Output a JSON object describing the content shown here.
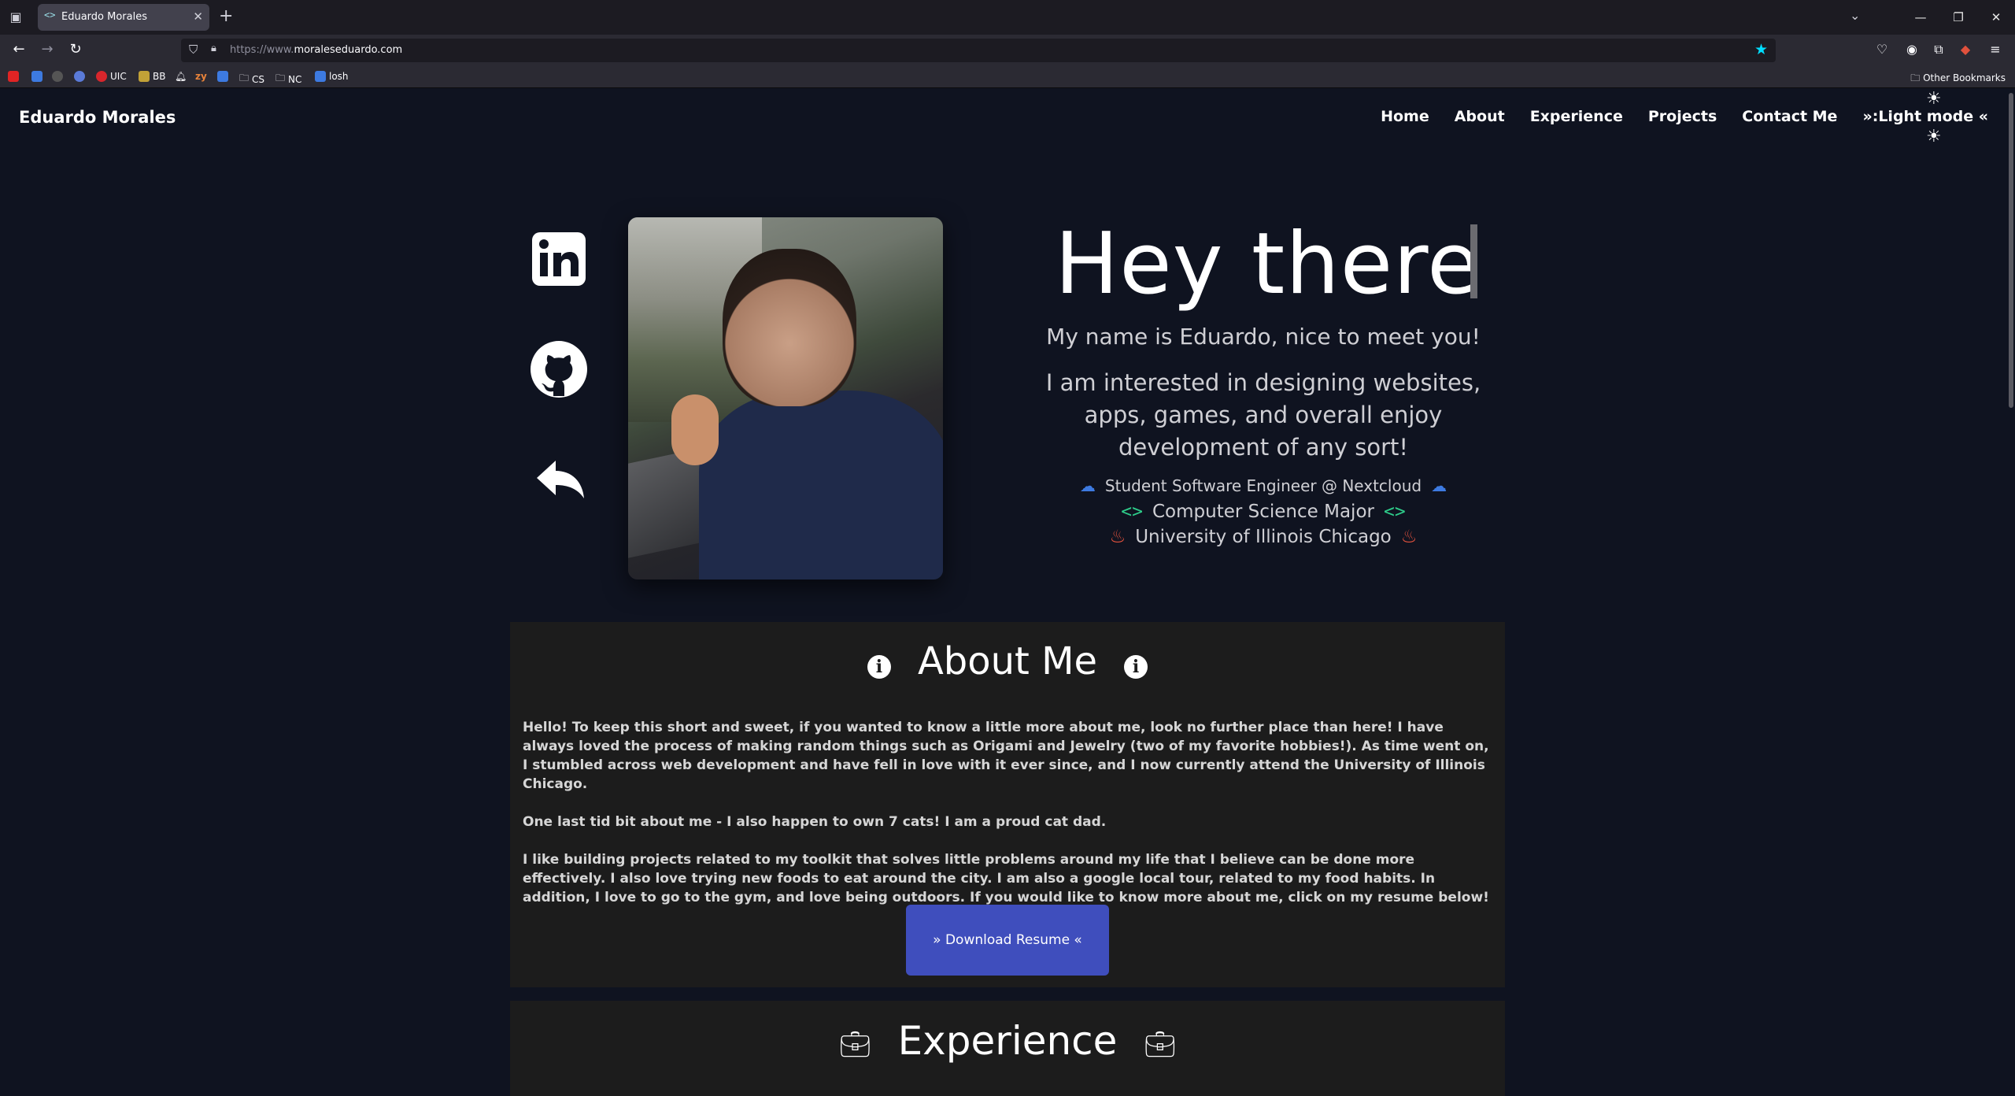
{
  "browser": {
    "tab_title": "Eduardo Morales",
    "tab_favicon": "<>",
    "url_prefix": "https://www.",
    "url_domain": "moraleseduardo.com",
    "bookmarks": [
      "UIC",
      "BB",
      "zy",
      "CS",
      "NC",
      "losh"
    ],
    "other_bookmarks": "Other Bookmarks"
  },
  "site": {
    "brand": "Eduardo Morales",
    "nav": [
      "Home",
      "About",
      "Experience",
      "Projects",
      "Contact Me",
      "»:Light mode «"
    ],
    "hero": {
      "title": "Hey there",
      "intro": "My name is Eduardo, nice to meet you!",
      "interest": "I am interested in designing websites, apps, games, and overall enjoy development of any sort!",
      "role": "Student Software Engineer @ Nextcloud",
      "major": "Computer Science Major",
      "school": "University of Illinois Chicago"
    },
    "about": {
      "title": "About Me",
      "p1": "Hello! To keep this short and sweet, if you wanted to know a little more about me, look no further place than here! I have always loved the process of making random things such as Origami and Jewelry (two of my favorite hobbies!). As time went on, I stumbled across web development and have fell in love with it ever since, and I now currently attend the University of Illinois Chicago.",
      "p2": "One last tid bit about me - I also happen to own 7 cats! I am a proud cat dad.",
      "p3": "I like building projects related to my toolkit that solves little problems around my life that I believe can be done more effectively. I also love trying new foods to eat around the city. I am also a google local tour, related to my food habits. In addition, I love to go to the gym, and love being outdoors. If you would like to know more about me, click on my resume below!",
      "button": "» Download Resume «"
    },
    "experience": {
      "title": "Experience"
    }
  },
  "colors": {
    "site_bg": "#0f1320",
    "card_bg": "#1c1c1c",
    "button_bg": "#3f4ebd",
    "cloud": "#3d7ae0",
    "code": "#2ecc8a",
    "fire": "#e0513d"
  }
}
